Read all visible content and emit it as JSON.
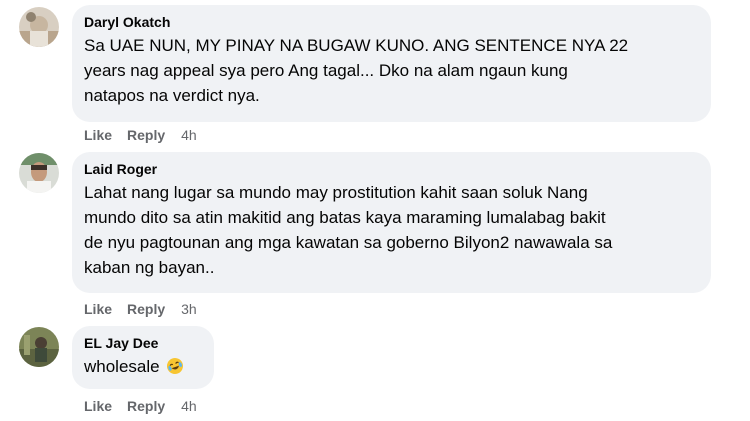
{
  "comments": [
    {
      "author": "Daryl Okatch",
      "text": "Sa UAE NUN, MY PINAY NA BUGAW KUNO. ANG SENTENCE NYA 22 years nag appeal sya pero Ang tagal... Dko na alam ngaun kung natapos na verdict nya.",
      "line1": "Sa UAE NUN, MY PINAY NA BUGAW KUNO. ANG SENTENCE NYA 22",
      "line2": "years nag appeal sya pero Ang tagal... Dko na alam ngaun kung",
      "line3": "natapos na verdict nya.",
      "like_label": "Like",
      "reply_label": "Reply",
      "time": "4h"
    },
    {
      "author": "Laid Roger",
      "line1": "Lahat nang lugar sa mundo may prostitution kahit saan soluk Nang",
      "line2": "mundo dito sa atin makitid ang batas kaya maraming lumalabag bakit",
      "line3": "de nyu pagtounan ang mga kawatan sa goberno Bilyon2 nawawala sa",
      "line4": "kaban ng bayan..",
      "like_label": "Like",
      "reply_label": "Reply",
      "time": "3h"
    },
    {
      "author": "EL Jay Dee",
      "line1": "wholesale",
      "emoji": "laughing-crying-emoji",
      "like_label": "Like",
      "reply_label": "Reply",
      "time": "4h"
    }
  ]
}
